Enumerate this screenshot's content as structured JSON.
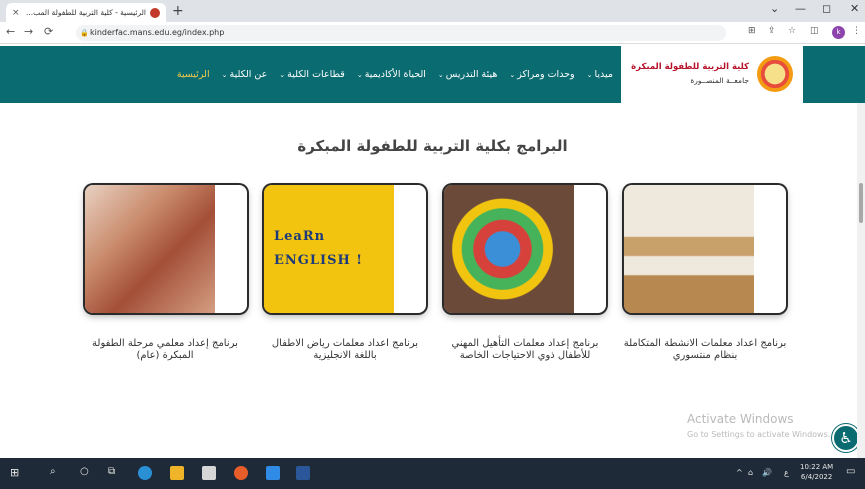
{
  "browser": {
    "tab_title": "الرئيسية - كلية التربية للطفولة المب...",
    "tab_close": "×",
    "new_tab": "+",
    "url": "kinderfac.mans.edu.eg/index.php",
    "profile_initial": "k",
    "controls": {
      "minimize": "—",
      "maximize": "◻",
      "close": "✕",
      "tabsearch": "⌄"
    }
  },
  "site": {
    "logo_line1": "كلية التربية للطفولة المبكرة",
    "logo_line2": "جامعــة المنصــورة",
    "nav": [
      {
        "label": "الرئيسية",
        "active": true,
        "dropdown": false
      },
      {
        "label": "عن الكلية",
        "active": false,
        "dropdown": true
      },
      {
        "label": "قطاعات الكلية",
        "active": false,
        "dropdown": true
      },
      {
        "label": "الحياة الأكاديمية",
        "active": false,
        "dropdown": true
      },
      {
        "label": "هيئة التدريس",
        "active": false,
        "dropdown": true
      },
      {
        "label": "وحدات ومراكز",
        "active": false,
        "dropdown": true
      },
      {
        "label": "ميديا",
        "active": false,
        "dropdown": true
      }
    ]
  },
  "main": {
    "section_title": "البرامج بكلية التربية للطفولة المبكرة",
    "programs": [
      {
        "caption": "برنامج اعداد معلمات الانشطة المتكاملة بنظام منتسوري"
      },
      {
        "caption": "برنامج إعداد معلمات التأهيل المهني للأطفال ذوي الاحتياجات الخاصة"
      },
      {
        "caption": "برنامج اعداد معلمات رياض الاطفال باللغة الانجليزية"
      },
      {
        "caption": "برنامج إعداد معلمي مرحلة الطفولة المبكرة (عام)"
      }
    ],
    "english_letters_1": "LeaRn",
    "english_letters_2": "ENGLISH !"
  },
  "watermark": {
    "line1": "Activate Windows",
    "line2": "Go to Settings to activate Windows."
  },
  "taskbar": {
    "time": "10:22 AM",
    "date": "6/4/2022",
    "lang": "ع"
  },
  "colors": {
    "header_bg": "#0a6b70",
    "nav_active": "#f2c94c",
    "logo_red": "#b7132a"
  }
}
